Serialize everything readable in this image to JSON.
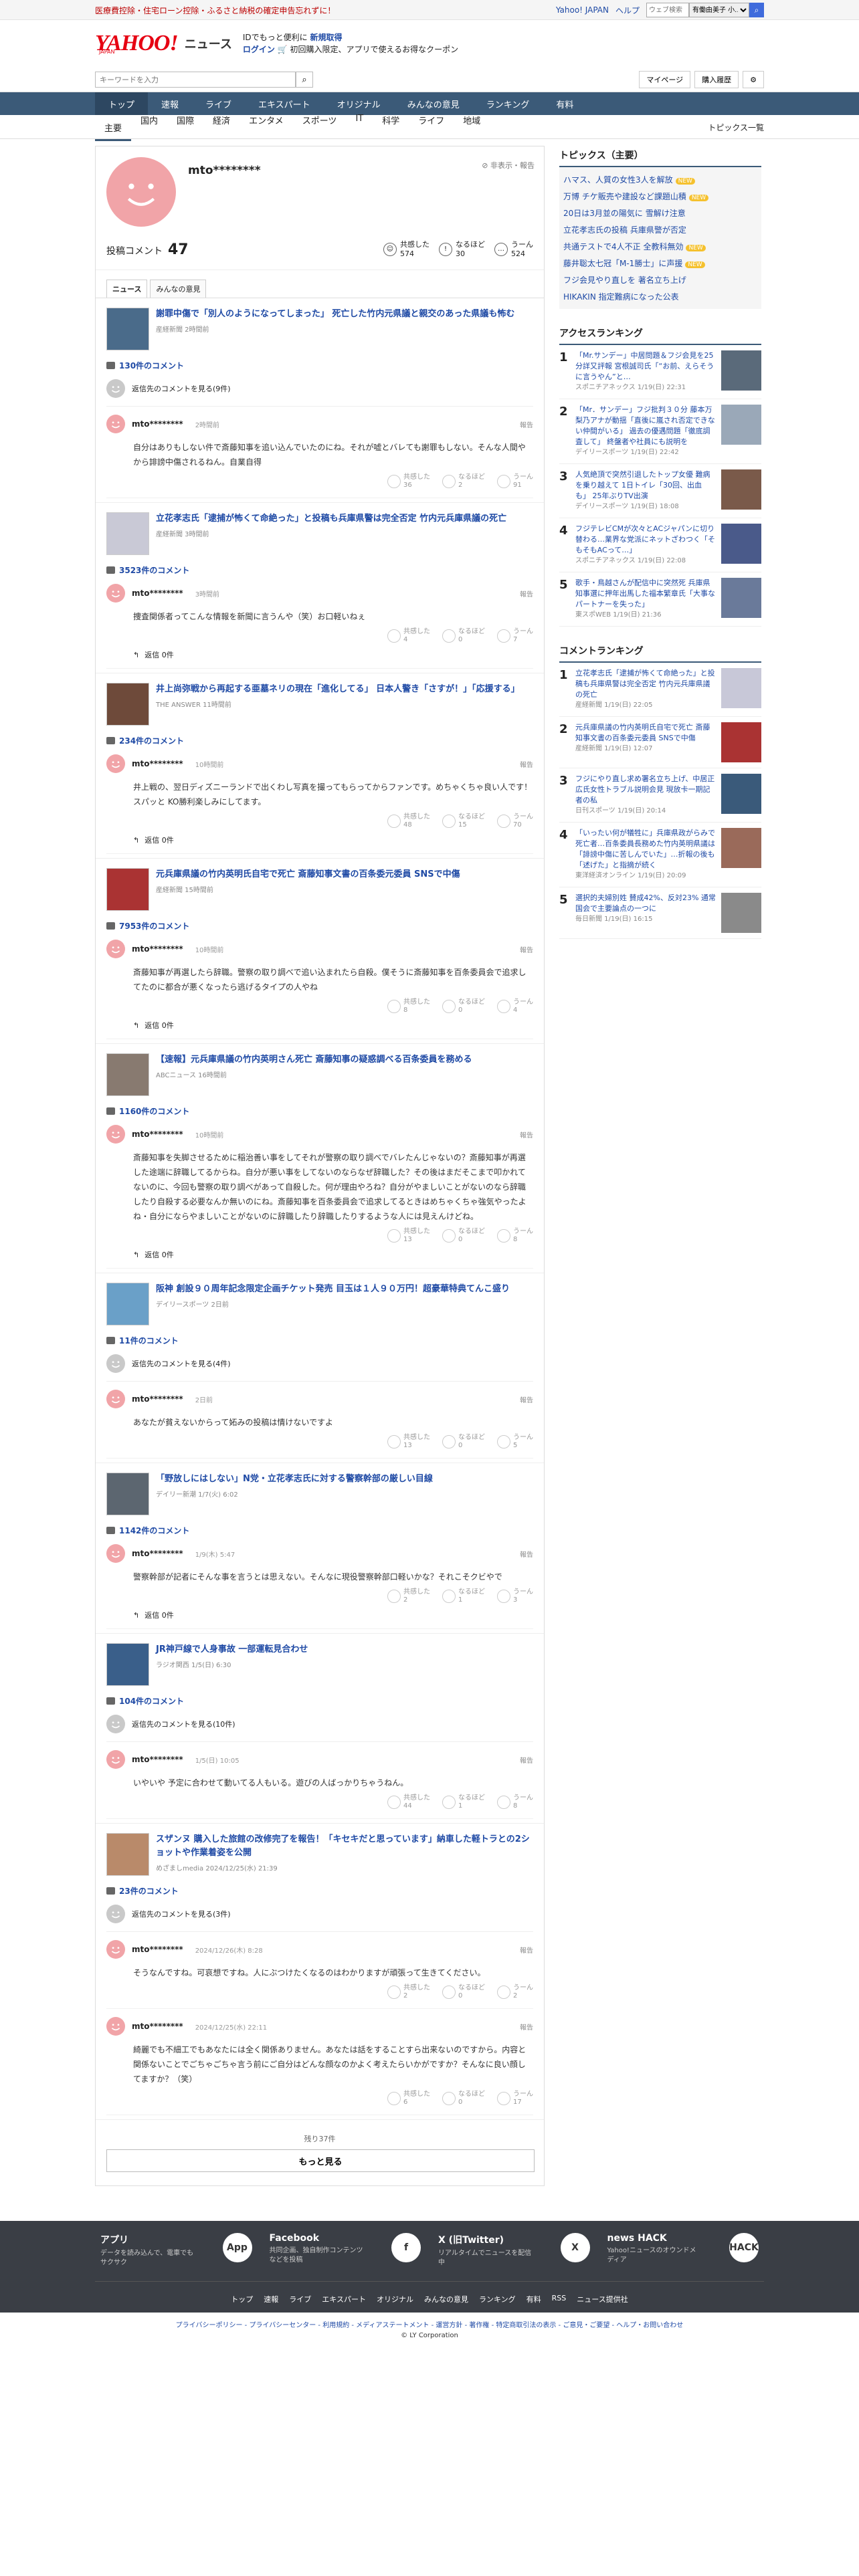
{
  "topbar": {
    "promo": "医療費控除・住宅ローン控除・ふるさと納税の確定申告忘れずに！",
    "links": [
      "Yahoo! JAPAN",
      "ヘルプ"
    ],
    "search_placeholder": "ウェブ検索",
    "select_label": "有働由美子 小..."
  },
  "header": {
    "logo": "YAHOO!",
    "logo_sub": "JAPAN",
    "news": "ニュース",
    "line1_pre": "IDでもっと便利に",
    "line1_link": "新規取得",
    "line2_link": "ログイン",
    "line2_rest": "初回購入限定、アプリで使えるお得なクーポン"
  },
  "search": {
    "placeholder": "キーワードを入力",
    "buttons": [
      "マイページ",
      "購入履歴"
    ]
  },
  "nav1": [
    "トップ",
    "速報",
    "ライブ",
    "エキスパート",
    "オリジナル",
    "みんなの意見",
    "ランキング",
    "有料"
  ],
  "nav2": {
    "items": [
      "主要",
      "国内",
      "国際",
      "経済",
      "エンタメ",
      "スポーツ",
      "IT",
      "科学",
      "ライフ",
      "地域"
    ],
    "right": "トピックス一覧"
  },
  "profile": {
    "name": "mto********",
    "meta": "非表示・報告",
    "comments_label": "投稿コメント",
    "comments": "47",
    "reacts": [
      {
        "label": "共感した",
        "count": "574",
        "icon": "☺"
      },
      {
        "label": "なるほど",
        "count": "30",
        "icon": "!"
      },
      {
        "label": "うーん",
        "count": "524",
        "icon": "…"
      }
    ]
  },
  "tabs": [
    "ニュース",
    "みんなの意見"
  ],
  "articles": [
    {
      "title": "謝罪中傷で「別人のようになってしまった」 死亡した竹内元県議と親交のあった県議も怖む",
      "src": "産経新聞 2時間前",
      "count": "130件のコメント",
      "prev": "返信先のコメントを見る(9件)",
      "user": "mto********",
      "time": "2時間前",
      "text": "自分はありもしない件で斎藤知事を追い込んでいたのにね。それが嘘とバレても謝罪もしない。そんな人間やから誹謗中傷されるねん。自業自得",
      "r": [
        "36",
        "2",
        "91"
      ],
      "replies": ""
    },
    {
      "title": "立花孝志氏「逮捕が怖くて命絶った」と投稿も兵庫県警は完全否定 竹内元兵庫県議の死亡",
      "src": "産経新聞 3時間前",
      "count": "3523件のコメント",
      "prev": "",
      "user": "mto********",
      "time": "3時間前",
      "text": "捜査関係者ってこんな情報を新聞に言うんや（笑）お口軽いねぇ",
      "r": [
        "4",
        "0",
        "7"
      ],
      "replies": "返信 0件"
    },
    {
      "title": "井上尚弥戦から再起する亜墓ネリの現在「進化してる」 日本人警き「さすが！」「応援する」",
      "src": "THE ANSWER 11時間前",
      "count": "234件のコメント",
      "prev": "",
      "user": "mto********",
      "time": "10時間前",
      "text": "井上戦の、翌日ディズニーランドで出くわし写真を撮ってもらってからファンです。めちゃくちゃ良い人です！スパッと KO勝利楽しみにしてます。",
      "r": [
        "48",
        "15",
        "70"
      ],
      "replies": "返信 0件"
    },
    {
      "title": "元兵庫県議の竹内英明氏自宅で死亡 斎藤知事文書の百条委元委員 SNSで中傷",
      "src": "産経新聞 15時間前",
      "count": "7953件のコメント",
      "prev": "",
      "user": "mto********",
      "time": "10時間前",
      "text": "斎藤知事が再選したら辞職。警察の取り調べで追い込まれたら自殺。僕そうに斎藤知事を百条委員会で追求してたのに都合が悪くなったら逃げるタイプの人やね",
      "r": [
        "8",
        "0",
        "4"
      ],
      "replies": "返信 0件"
    },
    {
      "title": "【速報】元兵庫県議の竹内英明さん死亡 斎藤知事の疑惑調べる百条委員を務める",
      "src": "ABCニュース 16時間前",
      "count": "1160件のコメント",
      "prev": "",
      "user": "mto********",
      "time": "10時間前",
      "text": "斎藤知事を失脚させるために稲治善い事をしてそれが警察の取り調べでバレたんじゃないの？斎藤知事が再選した途端に辞職してるからね。自分が悪い事をしてないのならなぜ辞職した？その後はまだそこまで叩かれてないのに、今回も警察の取り調べがあって自殺した。何が理由やろね？自分がやましいことがないのなら辞職したり自殺する必要なんか無いのにね。斎藤知事を百条委員会で追求してるときはめちゃくちゃ強気やったよね・自分にならやましいことがないのに辞職したり辞職したりするような人には見えんけどね。",
      "r": [
        "13",
        "0",
        "8"
      ],
      "replies": "返信 0件"
    },
    {
      "title": "阪神 創設９０周年記念限定企画チケット発売 目玉は１人９０万円！超豪華特典てんこ盛り",
      "src": "デイリースポーツ 2日前",
      "count": "11件のコメント",
      "prev": "返信先のコメントを見る(4件)",
      "user": "mto********",
      "time": "2日前",
      "text": "あなたが貧えないからって妬みの投稿は情けないですよ",
      "r": [
        "13",
        "0",
        "5"
      ],
      "replies": ""
    },
    {
      "title": "「野放しにはしない」N党・立花孝志氏に対する警察幹部の厳しい目線",
      "src": "デイリー新潮 1/7(火) 6:02",
      "count": "1142件のコメント",
      "prev": "",
      "user": "mto********",
      "time": "1/9(木) 5:47",
      "text": "警察幹部が記者にそんな事を言うとは思えない。そんなに現役警察幹部口軽いかな？それこそクビやで",
      "r": [
        "2",
        "1",
        "3"
      ],
      "replies": "返信 0件"
    },
    {
      "title": "JR神戸線で人身事故 一部運転見合わせ",
      "src": "ラジオ関西 1/5(日) 6:30",
      "count": "104件のコメント",
      "prev": "返信先のコメントを見る(10件)",
      "user": "mto********",
      "time": "1/5(日) 10:05",
      "text": "いやいや 予定に合わせて動いてる人もいる。遊びの人ばっかりちゃうねん。",
      "r": [
        "44",
        "1",
        "8"
      ],
      "replies": ""
    },
    {
      "title": "スザンヌ 購入した旅館の改修完了を報告！「キセキだと思っています」納車した軽トラとの2ショットや作業着姿を公開",
      "src": "めざましmedia 2024/12/25(水) 21:39",
      "count": "23件のコメント",
      "prev": "返信先のコメントを見る(3件)",
      "user": "mto********",
      "time": "2024/12/26(木) 8:28",
      "text": "そうなんですね。可哀想ですね。人にぶつけたくなるのはわかりますが頑張って生きてください。",
      "r": [
        "2",
        "0",
        "2"
      ],
      "replies": ""
    }
  ],
  "extra": {
    "user": "mto********",
    "time": "2024/12/25(水) 22:11",
    "text": "綺麗でも不細工でもあなたには全く関係ありません。あなたは話をすることすら出来ないのですから。内容と関係ないことでごちゃごちゃ言う前にご自分はどんな顔なのかよく考えたらいかがですか？そんなに良い顔してますか？（笑）",
    "r": [
      "6",
      "0",
      "17"
    ]
  },
  "react_labels": [
    "共感した",
    "なるほど",
    "うーん"
  ],
  "more": {
    "remain": "残り37件",
    "button": "もっと見る"
  },
  "side": {
    "topics_title": "トピックス（主要）",
    "topics": [
      {
        "t": "ハマス、人質の女性3人を解放",
        "n": "NEW"
      },
      {
        "t": "万博 チケ販売や建設など課題山積",
        "n": "NEW"
      },
      {
        "t": "20日は3月並の陽気に 雪解け注意",
        "n": ""
      },
      {
        "t": "立花孝志氏の投稿 兵庫県警が否定",
        "n": ""
      },
      {
        "t": "共通テストで4人不正 全教科無効",
        "n": "NEW"
      },
      {
        "t": "藤井聡太七冠「M-1勝士」に声援",
        "n": "NEW"
      },
      {
        "t": "フジ会見やり直しを 著名立ち上げ",
        "n": ""
      },
      {
        "t": "HIKAKIN 指定難病になった公表",
        "n": ""
      }
    ],
    "access_title": "アクセスランキング",
    "access": [
      {
        "t": "「Mr.サンデー」中居問題＆フジ会見を25分詳又評報 宮根誠司氏「“お前、えらそうに言うやん”と…",
        "s": "スポニチアネックス 1/19(日) 22:31"
      },
      {
        "t": "「Mr．サンデー」フジ批判３０分 藤本万梨乃アナが動揺「直後に嵐され否定できない仲間がいる」 過去の優遇問題「徹底調査して」 終盤者や社員にも説明を",
        "s": "デイリースポーツ 1/19(日) 22:42"
      },
      {
        "t": "人気絶頂で突然引退したトップ女優 難病を乗り越えて 1日トイレ「30回、出血も」 25年ぶりTV出演",
        "s": "デイリースポーツ 1/19(日) 18:08"
      },
      {
        "t": "フジテレビCMが次々とACジャパンに切り替わる…業界な党派にネットざわつく「そもそもACって…」",
        "s": "スポニチアネックス 1/19(日) 22:08"
      },
      {
        "t": "歌手・鳥越さんが配信中に突然死 兵庫県知事選に押年出馬した福本繁章氏「大事なパートナーを失った」",
        "s": "東スポWEB 1/19(日) 21:36"
      }
    ],
    "comment_title": "コメントランキング",
    "comment": [
      {
        "t": "立花孝志氏「逮捕が怖くて命絶った」と投稿も兵庫県警は完全否定 竹内元兵庫県議の死亡",
        "s": "産経新聞 1/19(日) 22:05"
      },
      {
        "t": "元兵庫県議の竹内英明氏自宅で死亡 斎藤知事文書の百条委元委員 SNSで中傷",
        "s": "産経新聞 1/19(日) 12:07"
      },
      {
        "t": "フジにやり直し求め署名立ち上げ、中居正広氏女性トラブル説明会見 現放卡一期記者の私",
        "s": "日刊スポーツ 1/19(日) 20:14"
      },
      {
        "t": "「いったい何が犠牲に」兵庫県政がらみで死亡者…百条委員長務めた竹内英明県議は「誹謗中傷に苦しんでいた」…折報の後も「述げた」と指摘が続く",
        "s": "東洋経済オンライン 1/19(日) 20:09"
      },
      {
        "t": "選択的夫婦別姓 賛成42%、反対23% 通常国会で主要論点の一つに",
        "s": "毎日新聞 1/19(日) 16:15"
      }
    ]
  },
  "footer": {
    "cards": [
      {
        "t": "アプリ",
        "d": "データを読み込んで、電車でもサクサク",
        "i": "App"
      },
      {
        "t": "Facebook",
        "d": "共同企画、独自制作コンテンツなどを投稿",
        "i": "f"
      },
      {
        "t": "X (旧Twitter)",
        "d": "リアルタイムでニュースを配信中",
        "i": "X"
      },
      {
        "t": "news HACK",
        "d": "Yahoo!ニュースのオウンドメディア",
        "i": "HACK"
      }
    ],
    "links": [
      "トップ",
      "速報",
      "ライブ",
      "エキスパート",
      "オリジナル",
      "みんなの意見",
      "ランキング",
      "有料",
      "RSS",
      "ニュース提供社"
    ],
    "bottom": "プライバシーポリシー - プライバシーセンター - 利用規約 - メディアステートメント - 運営方針 - 著作権 - 特定商取引法の表示 - ご意見・ご要望 - ヘルプ・お問い合わせ",
    "copy": "© LY Corporation"
  }
}
